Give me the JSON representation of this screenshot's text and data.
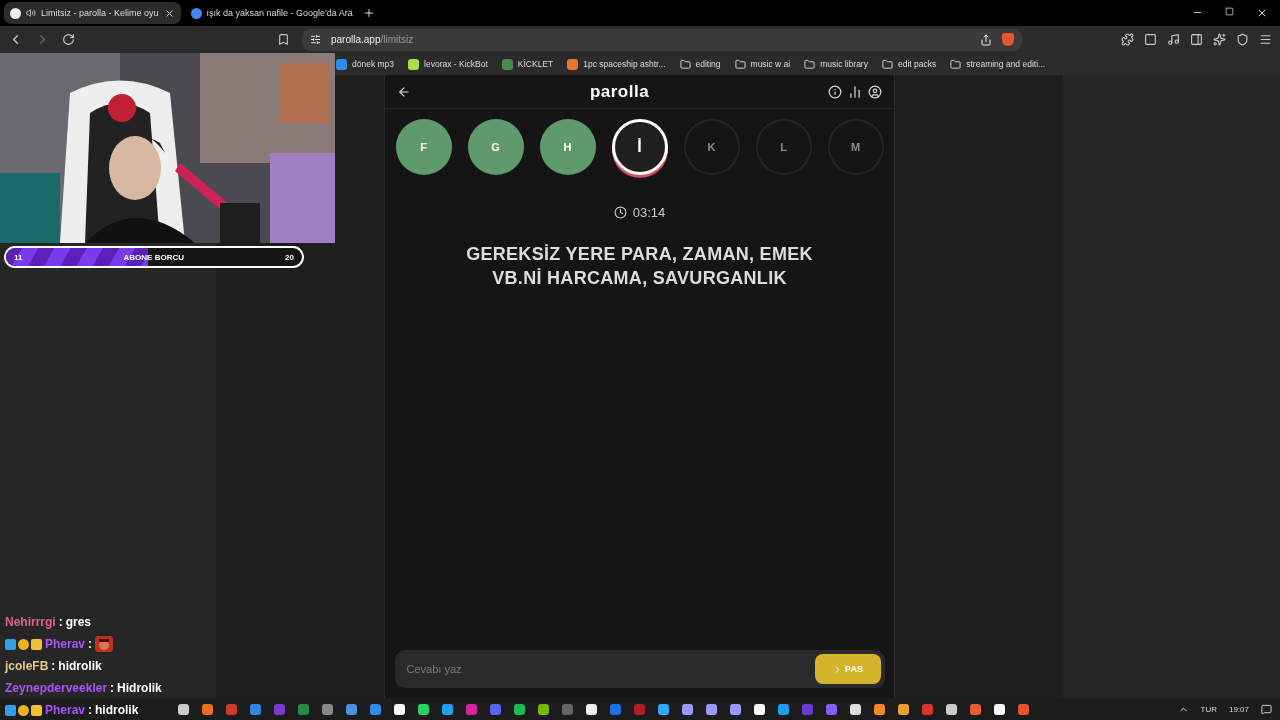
{
  "browser": {
    "tabs": [
      {
        "title": "Limitsiz - parolla - Kelime oyu",
        "selected": true,
        "audio": true
      },
      {
        "title": "ışık da yaksan nafile - Google'da Ara",
        "selected": false,
        "audio": false
      }
    ],
    "url_host": "parolla.app",
    "url_path": "/limitsiz",
    "bookmarks": [
      {
        "label": "dönek mp3",
        "kind": "site",
        "color": "#2f8fe8"
      },
      {
        "label": "levorax - KickBot",
        "kind": "site",
        "color": "#a8e04a"
      },
      {
        "label": "KİCKLET",
        "kind": "site",
        "color": "#4a8a4a"
      },
      {
        "label": "1pc spaceship ashtr...",
        "kind": "site",
        "color": "#e8762c"
      },
      {
        "label": "editing",
        "kind": "folder"
      },
      {
        "label": "music w ai",
        "kind": "folder"
      },
      {
        "label": "music library",
        "kind": "folder"
      },
      {
        "label": "edit packs",
        "kind": "folder"
      },
      {
        "label": "streaming and editi...",
        "kind": "folder"
      }
    ]
  },
  "game": {
    "title": "parolla",
    "letters": [
      {
        "letter": "F",
        "kind": "correct"
      },
      {
        "letter": "G",
        "kind": "correct"
      },
      {
        "letter": "H",
        "kind": "correct"
      },
      {
        "letter": "İ",
        "kind": "current"
      },
      {
        "letter": "K",
        "kind": "pending"
      },
      {
        "letter": "L",
        "kind": "pending"
      },
      {
        "letter": "M",
        "kind": "pending"
      }
    ],
    "timer": "03:14",
    "clue": "GEREKSİZ YERE PARA, ZAMAN, EMEK VB.Nİ HARCAMA, SAVURGANLIK",
    "answer": {
      "placeholder": "Cevabı yaz"
    },
    "pass_button": "PAS"
  },
  "stream": {
    "sub_goal": {
      "current": "11",
      "label": "ABONE BORCU",
      "target": "20",
      "level": 0.48
    },
    "chat": [
      {
        "user": "Nehirrrgi",
        "color": "#e0608a",
        "badges": false,
        "sep": ":",
        "text": "gres"
      },
      {
        "user": "Pherav",
        "color": "#a855f7",
        "badges": true,
        "sep": ":",
        "kind": "emote"
      },
      {
        "user": "jcoleFB",
        "color": "#e6c98a",
        "badges": false,
        "sep": ":",
        "text": "hidrolik"
      },
      {
        "user": "Zeynepderveekler",
        "color": "#a855f7",
        "badges": false,
        "sep": ":",
        "text": "Hidrolik"
      },
      {
        "user": "Pherav",
        "color": "#a855f7",
        "badges": true,
        "sep": ":",
        "text": "hidrolik"
      }
    ]
  },
  "taskbar": {
    "language": "TUR",
    "time": "19:07"
  }
}
